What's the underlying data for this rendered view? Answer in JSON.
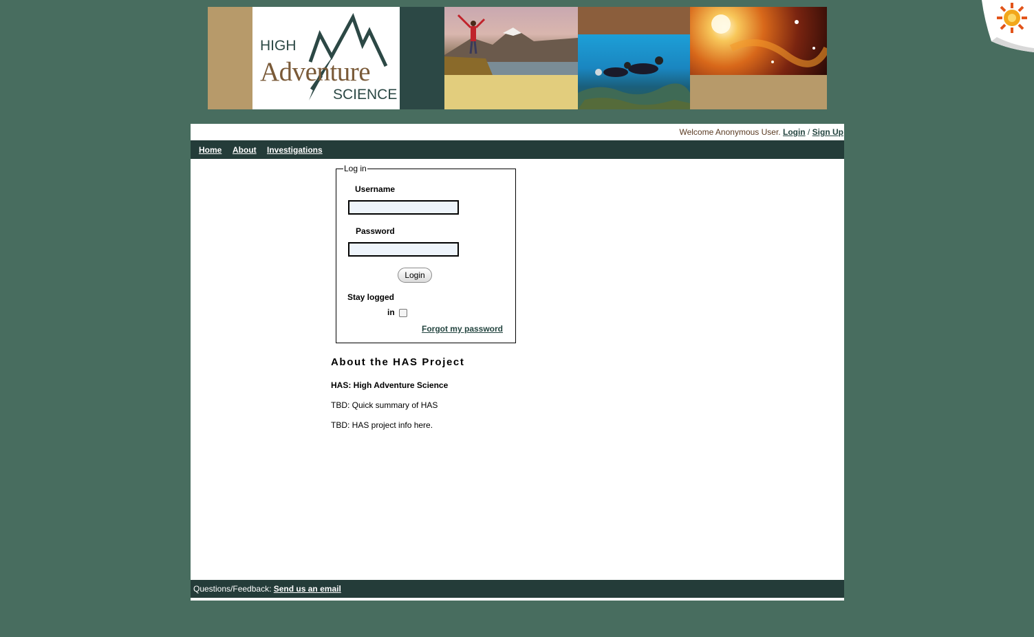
{
  "banner": {
    "logo": {
      "line1": "HIGH",
      "line2": "Adventure",
      "line3": "SCIENCE"
    },
    "colors": {
      "tan": "#b79a6a",
      "dark": "#2c4845",
      "sand": "#e2cd7d",
      "brown": "#8b5e3c"
    },
    "images": [
      "hiker-on-mountain-photo",
      "scuba-divers-photo",
      "nebula-photo"
    ]
  },
  "header": {
    "welcome_text": "Welcome Anonymous User.",
    "login_link": "Login",
    "separator": "/",
    "signup_link": "Sign Up"
  },
  "nav": {
    "items": [
      {
        "label": "Home"
      },
      {
        "label": "About"
      },
      {
        "label": "Investigations"
      }
    ]
  },
  "login": {
    "legend": "Log in",
    "username_label": "Username",
    "username_value": "",
    "password_label": "Password",
    "password_value": "",
    "button_label": "Login",
    "stay_label_1": "Stay logged",
    "stay_label_2": "in",
    "stay_checked": false,
    "forgot_link": "Forgot my password"
  },
  "about": {
    "title": "About the HAS Project",
    "subtitle": "HAS: High Adventure Science",
    "line1": "TBD: Quick summary of HAS",
    "line2": "TBD: HAS project info here."
  },
  "footer": {
    "label": "Questions/Feedback:",
    "link": "Send us an email"
  },
  "theme": {
    "background": "#486d5f",
    "nav_bg": "#243c39",
    "link_color": "#23443f"
  }
}
